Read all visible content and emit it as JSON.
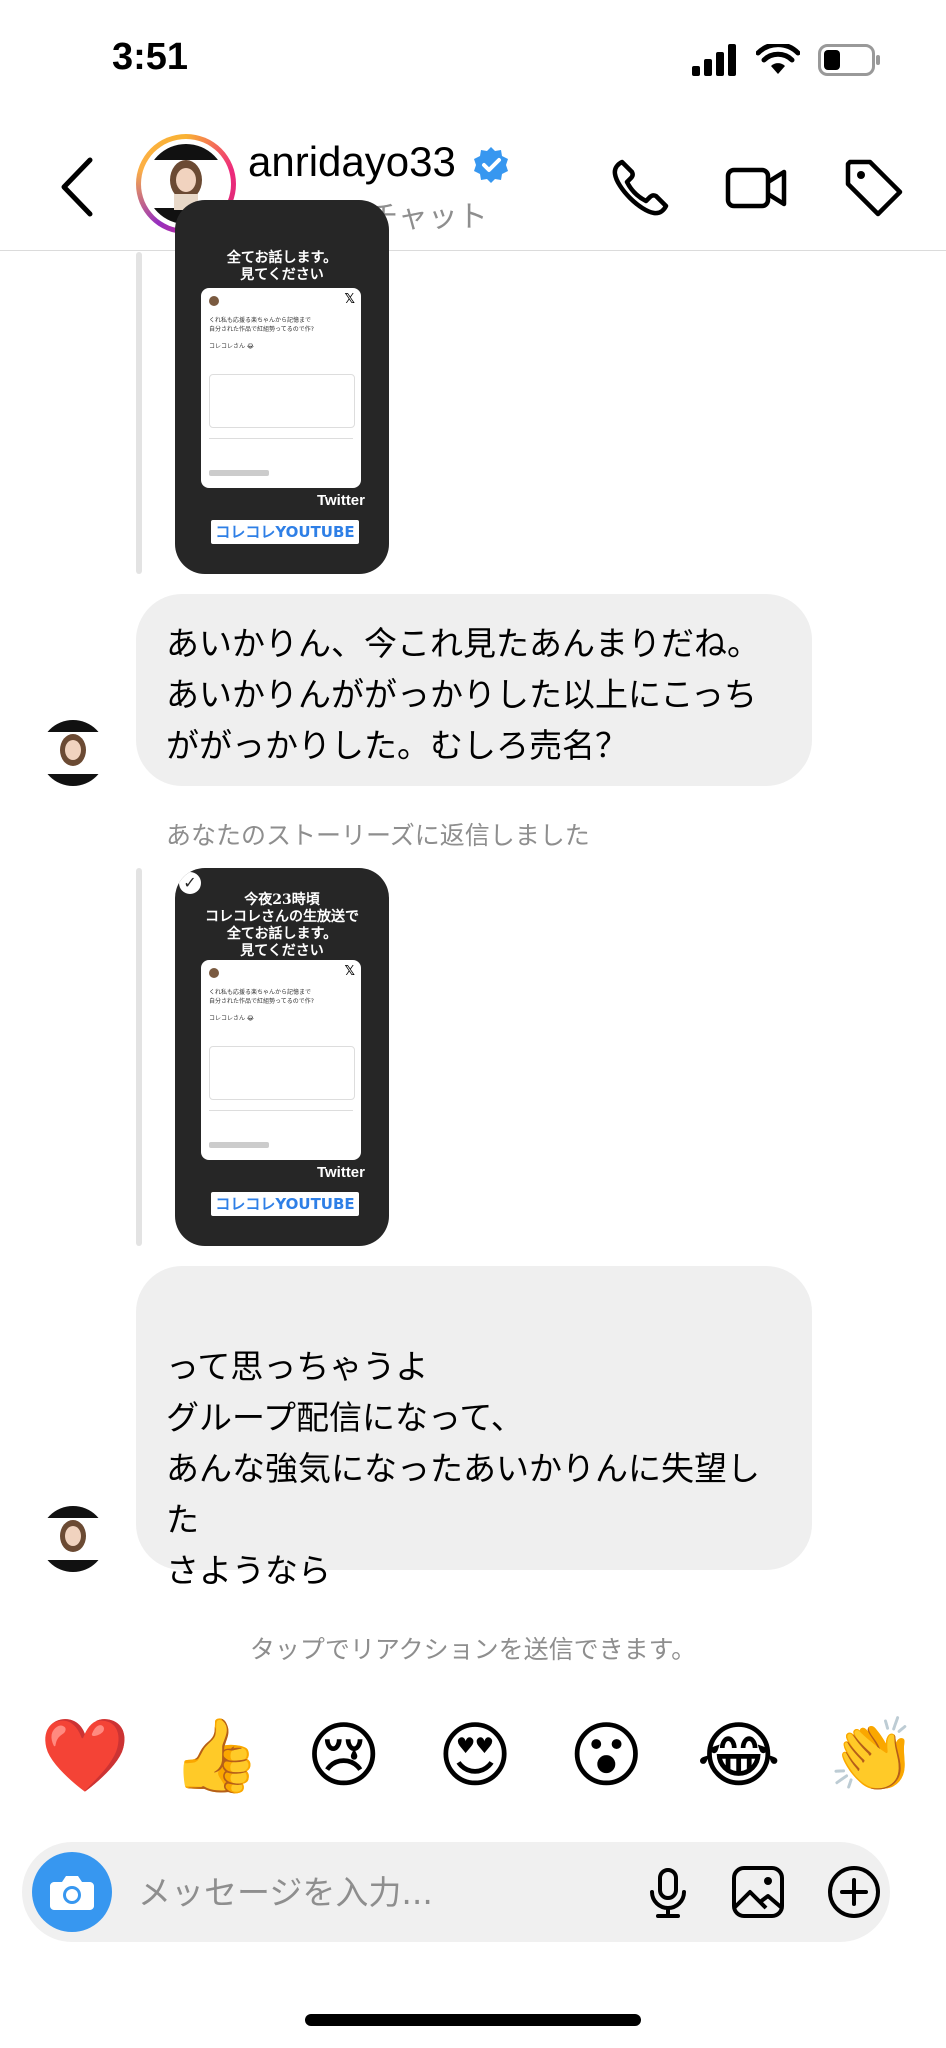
{
  "status_bar": {
    "time": "3:51",
    "battery_level": 0.35
  },
  "header": {
    "name": "anridayo33",
    "verified": true,
    "subtitle": "ビジネスチャット",
    "icons": [
      "back-icon",
      "phone-icon",
      "video-icon",
      "tag-icon"
    ]
  },
  "story1": {
    "headline": [
      "全てお話します。",
      "見てください"
    ],
    "tweet_lines": [
      "くれ私も応援る楽ちゃんから記憶まで",
      "自分された作品で紅組勢ってるので作?",
      "コレコレさん 😂"
    ],
    "twitter_label": "Twitter",
    "link_label": "コレコレYOUTUBE"
  },
  "messages": [
    {
      "text": "あいかりん、今これ見たあんまりだね。あいかりんががっかりした以上にこっちががっかりした。むしろ売名？"
    },
    {
      "text": "って思っちゃうよ\nグループ配信になって、\nあんな強気になったあいかりんに失望した\nさようなら"
    }
  ],
  "reply_note": "あなたのストーリーズに返信しました",
  "story2": {
    "headline": [
      "今夜23時頃",
      "コレコレさんの生放送で",
      "全てお話します。",
      "見てください"
    ],
    "tweet_lines": [
      "くれ私も応援る楽ちゃんから記憶まで",
      "自分された作品で紅組勢ってるので作?",
      "コレコレさん 😂"
    ],
    "twitter_label": "Twitter",
    "link_label": "コレコレYOUTUBE"
  },
  "reaction_hint": "タップでリアクションを送信できます。",
  "reactions": [
    "❤️",
    "👍",
    "😢",
    "😍",
    "😮",
    "😂",
    "👏"
  ],
  "composer": {
    "placeholder": "メッセージを入力..."
  },
  "colors": {
    "accent": "#3797f0",
    "bubble": "#efefef",
    "muted": "#8e8e8e"
  }
}
